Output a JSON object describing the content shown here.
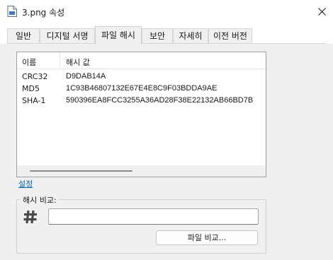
{
  "window": {
    "title": "3.png 속성",
    "file_icon": "file-image-icon",
    "close_icon": "close-icon"
  },
  "tabs": [
    {
      "label": "일반"
    },
    {
      "label": "디지털 서명"
    },
    {
      "label": "파일 해시",
      "active": true
    },
    {
      "label": "보안"
    },
    {
      "label": "자세히"
    },
    {
      "label": "이전 버전"
    }
  ],
  "hash_list": {
    "columns": [
      "이름",
      "해시 값"
    ],
    "rows": [
      {
        "name": "CRC32",
        "value": "D9DAB14A"
      },
      {
        "name": "MD5",
        "value": "1C93B46807132E67E4E8C9F03BDDA9AE"
      },
      {
        "name": "SHA-1",
        "value": "590396EA8FCC3255A36AD28F38E22132AB66BD7B"
      }
    ]
  },
  "settings_link": "설정",
  "compare": {
    "group_label": "해시 비교:",
    "hash_icon": "hash-icon",
    "input_value": "",
    "button_label": "파일 비교..."
  },
  "colors": {
    "link": "#0067c0",
    "background": "#f0f0f0"
  }
}
